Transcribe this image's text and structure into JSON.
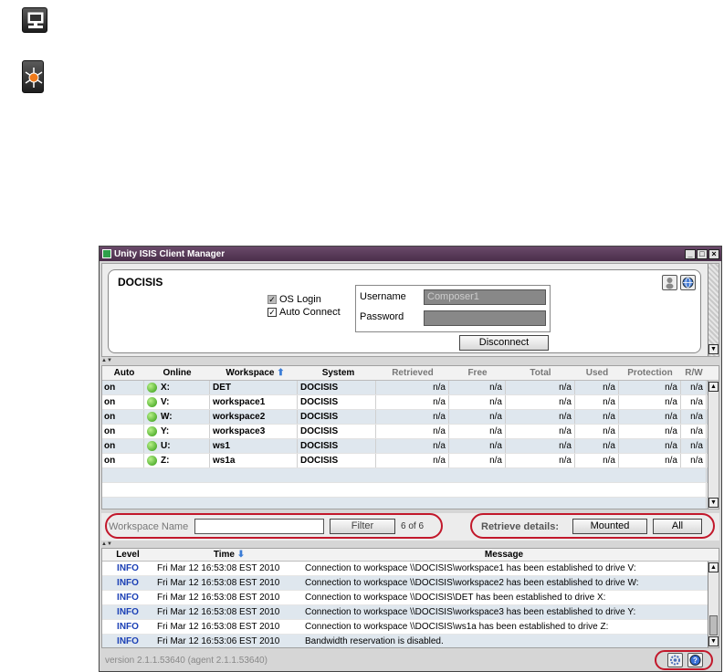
{
  "window": {
    "title": "Unity ISIS Client Manager"
  },
  "connection": {
    "server": "DOCISIS",
    "os_login_label": "OS Login",
    "auto_connect_label": "Auto Connect",
    "username_label": "Username",
    "username_value": "Composer1",
    "password_label": "Password",
    "disconnect_label": "Disconnect"
  },
  "table": {
    "headers": {
      "auto": "Auto",
      "online": "Online",
      "workspace": "Workspace",
      "system": "System",
      "retrieved": "Retrieved",
      "free": "Free",
      "total": "Total",
      "used": "Used",
      "protection": "Protection",
      "rw": "R/W"
    },
    "rows": [
      {
        "auto": "on",
        "drive": "X:",
        "workspace": "DET",
        "system": "DOCISIS",
        "retrieved": "n/a",
        "free": "n/a",
        "total": "n/a",
        "used": "n/a",
        "protection": "n/a",
        "rw": "n/a"
      },
      {
        "auto": "on",
        "drive": "V:",
        "workspace": "workspace1",
        "system": "DOCISIS",
        "retrieved": "n/a",
        "free": "n/a",
        "total": "n/a",
        "used": "n/a",
        "protection": "n/a",
        "rw": "n/a"
      },
      {
        "auto": "on",
        "drive": "W:",
        "workspace": "workspace2",
        "system": "DOCISIS",
        "retrieved": "n/a",
        "free": "n/a",
        "total": "n/a",
        "used": "n/a",
        "protection": "n/a",
        "rw": "n/a"
      },
      {
        "auto": "on",
        "drive": "Y:",
        "workspace": "workspace3",
        "system": "DOCISIS",
        "retrieved": "n/a",
        "free": "n/a",
        "total": "n/a",
        "used": "n/a",
        "protection": "n/a",
        "rw": "n/a"
      },
      {
        "auto": "on",
        "drive": "U:",
        "workspace": "ws1",
        "system": "DOCISIS",
        "retrieved": "n/a",
        "free": "n/a",
        "total": "n/a",
        "used": "n/a",
        "protection": "n/a",
        "rw": "n/a"
      },
      {
        "auto": "on",
        "drive": "Z:",
        "workspace": "ws1a",
        "system": "DOCISIS",
        "retrieved": "n/a",
        "free": "n/a",
        "total": "n/a",
        "used": "n/a",
        "protection": "n/a",
        "rw": "n/a"
      }
    ]
  },
  "filter": {
    "placeholder": "Workspace Name",
    "button_label": "Filter",
    "count": "6 of 6",
    "retrieve_label": "Retrieve details:",
    "mounted_label": "Mounted",
    "all_label": "All"
  },
  "log": {
    "headers": {
      "level": "Level",
      "time": "Time",
      "message": "Message"
    },
    "rows": [
      {
        "level": "INFO",
        "time": "Fri Mar 12 16:53:08 EST 2010",
        "message": "Connection to workspace \\\\DOCISIS\\workspace1 has been established to drive V:"
      },
      {
        "level": "INFO",
        "time": "Fri Mar 12 16:53:08 EST 2010",
        "message": "Connection to workspace \\\\DOCISIS\\workspace2 has been established to drive W:"
      },
      {
        "level": "INFO",
        "time": "Fri Mar 12 16:53:08 EST 2010",
        "message": "Connection to workspace \\\\DOCISIS\\DET has been established to drive X:"
      },
      {
        "level": "INFO",
        "time": "Fri Mar 12 16:53:08 EST 2010",
        "message": "Connection to workspace \\\\DOCISIS\\workspace3 has been established to drive Y:"
      },
      {
        "level": "INFO",
        "time": "Fri Mar 12 16:53:08 EST 2010",
        "message": "Connection to workspace \\\\DOCISIS\\ws1a has been established to drive Z:"
      },
      {
        "level": "INFO",
        "time": "Fri Mar 12 16:53:06 EST 2010",
        "message": "Bandwidth reservation is disabled."
      }
    ]
  },
  "status": {
    "version": "version 2.1.1.53640 (agent 2.1.1.53640)"
  },
  "icons": {
    "top1": "monitor-network-icon",
    "top2": "network-hub-icon",
    "user": "user-icon",
    "globe": "globe-icon",
    "settings": "settings-icon",
    "help": "help-icon"
  },
  "colors": {
    "highlight": "#c2182b",
    "title_bar": "#4a2e4a",
    "online": "#2f9a10",
    "info": "#1a3fb5"
  }
}
